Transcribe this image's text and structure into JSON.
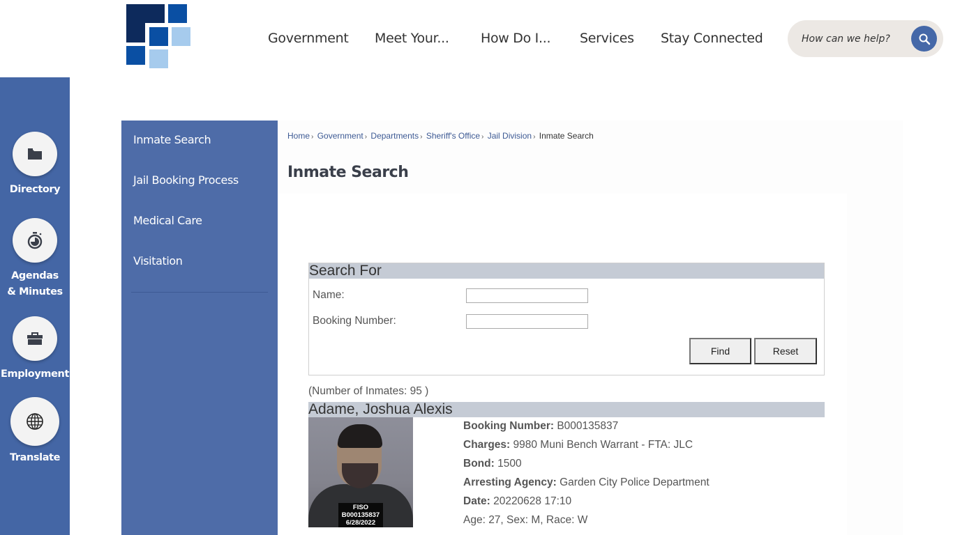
{
  "header": {
    "logo_alt": "site-logo",
    "nav": [
      {
        "label": "Government"
      },
      {
        "label": "Meet Your..."
      },
      {
        "label": "How Do I..."
      },
      {
        "label": "Services"
      },
      {
        "label": "Stay Connected"
      }
    ],
    "search": {
      "placeholder": "How can we help?",
      "value": "",
      "icon": "search-icon"
    }
  },
  "quick_links": [
    {
      "label": "Directory",
      "icon": "folder-icon"
    },
    {
      "label": "Agendas & Minutes",
      "icon": "stopwatch-icon"
    },
    {
      "label": "Employment",
      "icon": "briefcase-icon"
    },
    {
      "label": "Translate",
      "icon": "globe-icon"
    }
  ],
  "subnav": {
    "items": [
      {
        "label": "Inmate Search"
      },
      {
        "label": "Jail Booking Process"
      },
      {
        "label": "Medical Care"
      },
      {
        "label": "Visitation"
      }
    ]
  },
  "breadcrumb": {
    "items": [
      {
        "label": "Home"
      },
      {
        "label": "Government"
      },
      {
        "label": "Departments"
      },
      {
        "label": "Sheriff's Office"
      },
      {
        "label": "Jail Division"
      }
    ],
    "current": "Inmate Search",
    "separator": "›"
  },
  "page_title": "Inmate Search",
  "search_form": {
    "heading": "Search For",
    "name_label": "Name:",
    "name_value": "",
    "booking_label": "Booking Number:",
    "booking_value": "",
    "find_label": "Find",
    "reset_label": "Reset"
  },
  "results": {
    "count_text": "(Number of Inmates: 95 )",
    "inmates": [
      {
        "name": "Adame, Joshua Alexis",
        "photo_placard": [
          "FISO",
          "B000135837",
          "6/28/2022"
        ],
        "booking_number_label": "Booking Number:",
        "booking_number": "B000135837",
        "charges_label": "Charges:",
        "charges": "9980 Muni Bench Warrant - FTA: JLC",
        "bond_label": "Bond:",
        "bond": "1500",
        "agency_label": "Arresting Agency:",
        "agency": "Garden City Police Department",
        "date_label": "Date:",
        "date": "20220628 17:10",
        "demographics": "Age: 27, Sex: M, Race: W"
      }
    ]
  },
  "colors": {
    "brand_blue": "#4466a5",
    "subnav_blue": "#4e6ca8",
    "search_button": "#4568a8",
    "table_header": "#c5cbd5",
    "logo_navy": "#0d2a5c",
    "logo_blue": "#0a4fa3",
    "logo_light": "#a6cbed"
  }
}
